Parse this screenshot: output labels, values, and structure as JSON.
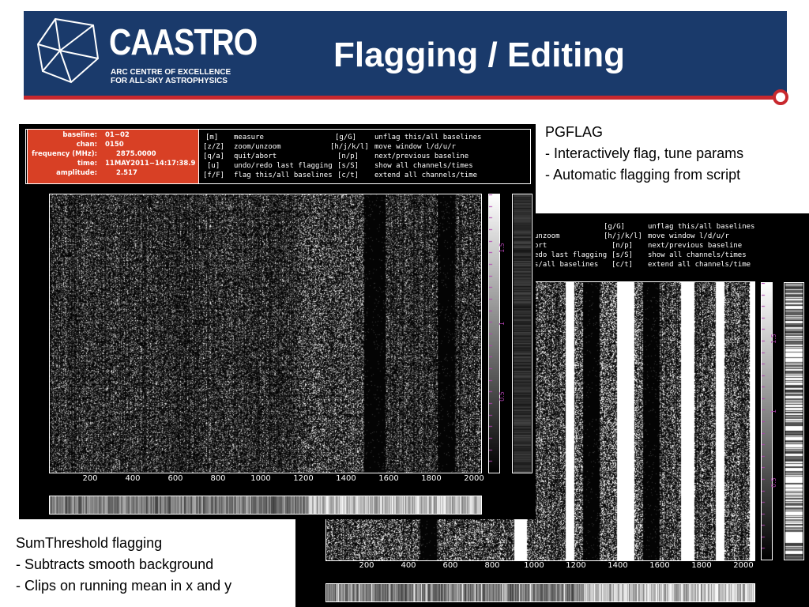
{
  "slide": {
    "title": "Flagging / Editing",
    "colors": {
      "banner": "#1a3a6b",
      "accent": "#c8282e",
      "info_box": "#d84025",
      "colorbar": "#b040b0"
    }
  },
  "logo": {
    "name": "CAASTRO",
    "line1": "ARC CENTRE OF EXCELLENCE",
    "line2": "FOR ALL-SKY ASTROPHYSICS",
    "icon": "polyhedron-icon"
  },
  "notes": {
    "pgflag": [
      "PGFLAG",
      "- Interactively flag, tune params",
      "- Automatic flagging from script"
    ],
    "sumthreshold": [
      "SumThreshold flagging",
      "- Subtracts smooth background",
      "- Clips on running mean in x and y"
    ]
  },
  "pgflag_window": {
    "info": [
      {
        "label": "baseline:",
        "value": "01−02"
      },
      {
        "label": "chan:",
        "value": "0150"
      },
      {
        "label": "frequency (MHz):",
        "value": "2875.0000"
      },
      {
        "label": "time:",
        "value": "11MAY2011−14:17:38.9"
      },
      {
        "label": "amplitude:",
        "value": "2.517"
      }
    ],
    "commands": [
      {
        "key": "[m]",
        "desc": "measure",
        "key2": "[g/G]",
        "desc2": "unflag this/all baselines"
      },
      {
        "key": "[z/Z]",
        "desc": "zoom/unzoom",
        "key2": "[h/j/k/l]",
        "desc2": "move window l/d/u/r"
      },
      {
        "key": "[q/a]",
        "desc": "quit/abort",
        "key2": "[n/p]",
        "desc2": "next/previous baseline"
      },
      {
        "key": "[u]",
        "desc": "undo/redo last flagging",
        "key2": "[s/S]",
        "desc2": "show all channels/times"
      },
      {
        "key": "[f/F]",
        "desc": "flag this/all baselines",
        "key2": "[c/t]",
        "desc2": "extend all channels/time"
      }
    ],
    "x_ticks": [
      "200",
      "400",
      "600",
      "800",
      "1000",
      "1200",
      "1400",
      "1600",
      "1800",
      "2000"
    ],
    "colorbar_ticks": [
      "1.5",
      "1",
      "0.5"
    ]
  },
  "sumthreshold_window": {
    "commands": [
      {
        "desc": "unzoom",
        "key2": "[h/j/k/l]",
        "desc2": "move window l/d/u/r"
      },
      {
        "desc": "ort",
        "key2": "[n/p]",
        "desc2": "next/previous baseline"
      },
      {
        "desc": "edo last flagging",
        "key2": "[s/S]",
        "desc2": "show all channels/times"
      },
      {
        "desc": "s/all baselines",
        "key2": "[c/t]",
        "desc2": "extend all channels/time"
      }
    ],
    "top_row": {
      "key2": "[g/G]",
      "desc2": "unflag this/all baselines"
    },
    "x_ticks": [
      "200",
      "400",
      "600",
      "800",
      "1000",
      "1200",
      "1400",
      "1600",
      "1800",
      "2000"
    ],
    "colorbar_ticks": [
      "1.5",
      "1",
      "0.5"
    ]
  }
}
